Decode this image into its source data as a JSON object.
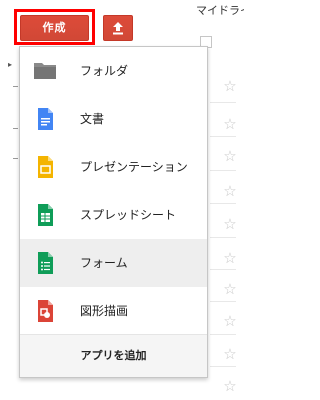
{
  "toolbar": {
    "create_label": "作成",
    "highlight_color": "#ff0000",
    "brand_color": "#d14836"
  },
  "background": {
    "header_right": "マイドライ"
  },
  "create_menu": {
    "items": [
      {
        "label": "フォルダ",
        "icon": "folder-icon",
        "color": "#8a8a8a"
      },
      {
        "label": "文書",
        "icon": "document-icon",
        "color": "#4285f4"
      },
      {
        "label": "プレゼンテーション",
        "icon": "presentation-icon",
        "color": "#f4b400"
      },
      {
        "label": "スプレッドシート",
        "icon": "spreadsheet-icon",
        "color": "#0f9d58"
      },
      {
        "label": "フォーム",
        "icon": "form-icon",
        "color": "#0f9d58",
        "hovered": true
      },
      {
        "label": "図形描画",
        "icon": "drawing-icon",
        "color": "#db4437"
      }
    ],
    "footer_label": "アプリを追加"
  }
}
